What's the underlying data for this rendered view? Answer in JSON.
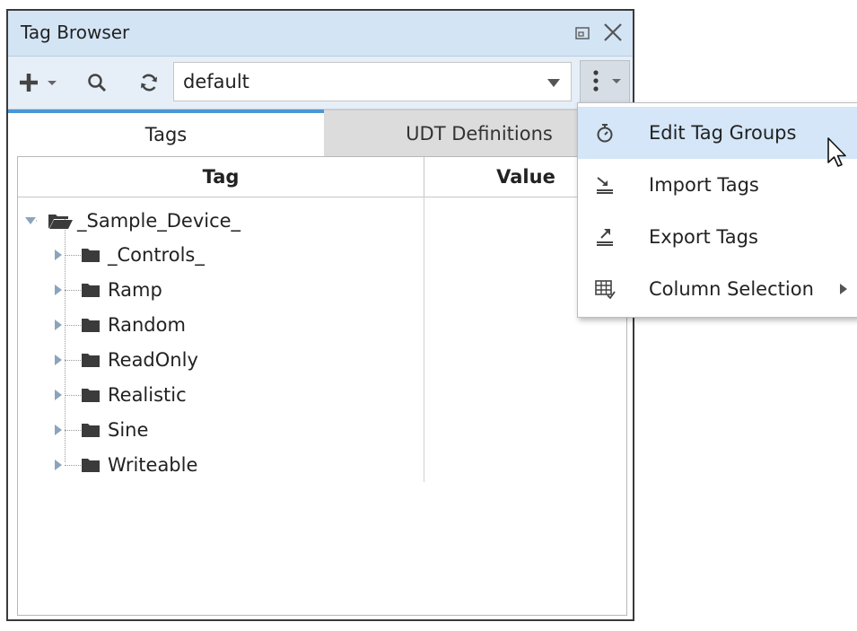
{
  "panel": {
    "title": "Tag Browser"
  },
  "toolbar": {
    "add_icon": "plus-icon",
    "search_icon": "search-icon",
    "refresh_icon": "refresh-icon",
    "provider_value": "default",
    "more_icon": "kebab-menu-icon"
  },
  "tabs": [
    {
      "label": "Tags",
      "active": true
    },
    {
      "label": "UDT Definitions",
      "active": false
    }
  ],
  "columns": {
    "tag": "Tag",
    "value": "Value"
  },
  "tree": {
    "root": {
      "label": "_Sample_Device_",
      "expanded": true
    },
    "children": [
      {
        "label": "_Controls_"
      },
      {
        "label": "Ramp"
      },
      {
        "label": "Random"
      },
      {
        "label": "ReadOnly"
      },
      {
        "label": "Realistic"
      },
      {
        "label": "Sine"
      },
      {
        "label": "Writeable"
      }
    ]
  },
  "menu": {
    "items": [
      {
        "label": "Edit Tag Groups",
        "icon": "stopwatch-icon",
        "highlighted": true
      },
      {
        "label": "Import Tags",
        "icon": "import-icon"
      },
      {
        "label": "Export Tags",
        "icon": "export-icon"
      },
      {
        "label": "Column Selection",
        "icon": "table-columns-icon",
        "submenu": true
      }
    ]
  },
  "colors": {
    "titlebar": "#d3e4f5",
    "toolbar": "#e6eef7",
    "tab_accent": "#4a97d6",
    "menu_highlight": "#d4e6f7",
    "folder": "#3b3b3b"
  }
}
